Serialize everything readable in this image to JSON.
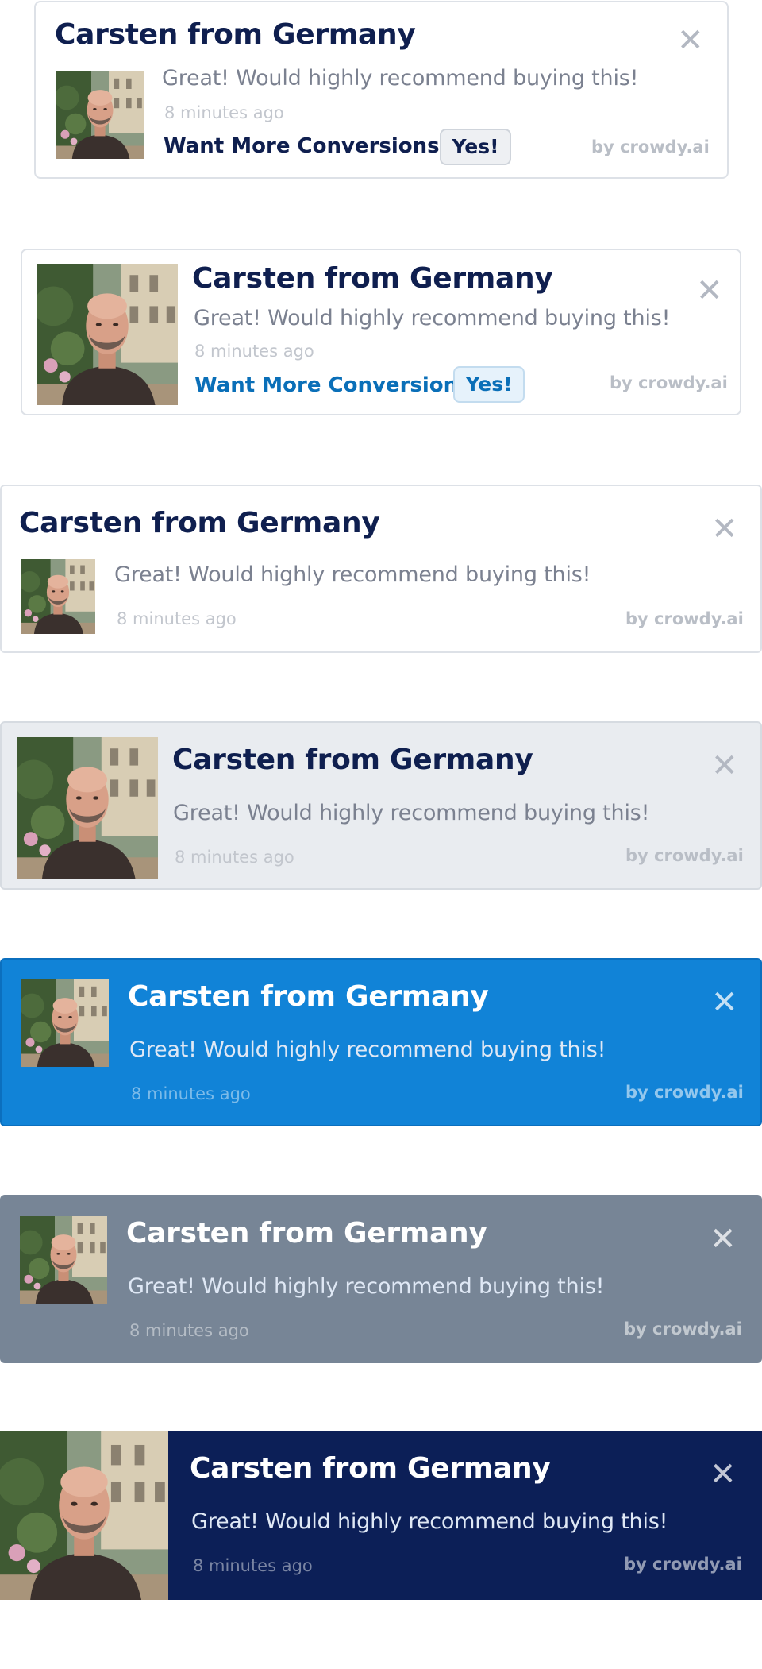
{
  "notifications": [
    {
      "title": "Carsten from Germany",
      "message": "Great! Would highly recommend buying this!",
      "time": "8 minutes ago",
      "cta": "Want More Conversions?",
      "yes": "Yes!",
      "by": "by crowdy.ai",
      "close": "✕"
    },
    {
      "title": "Carsten from Germany",
      "message": "Great! Would highly recommend buying this!",
      "time": "8 minutes ago",
      "cta": "Want More Conversions?",
      "yes": "Yes!",
      "by": "by crowdy.ai",
      "close": "✕"
    },
    {
      "title": "Carsten from Germany",
      "message": "Great! Would highly recommend buying this!",
      "time": "8 minutes ago",
      "by": "by crowdy.ai",
      "close": "✕"
    },
    {
      "title": "Carsten from Germany",
      "message": "Great! Would highly recommend buying this!",
      "time": "8 minutes ago",
      "by": "by crowdy.ai",
      "close": "✕"
    },
    {
      "title": "Carsten from Germany",
      "message": "Great! Would highly recommend buying this!",
      "time": "8 minutes ago",
      "by": "by crowdy.ai",
      "close": "✕"
    },
    {
      "title": "Carsten from Germany",
      "message": "Great! Would highly recommend buying this!",
      "time": "8 minutes ago",
      "by": "by crowdy.ai",
      "close": "✕"
    },
    {
      "title": "Carsten from Germany",
      "message": "Great! Would highly recommend buying this!",
      "time": "8 minutes ago",
      "by": "by crowdy.ai",
      "close": "✕"
    }
  ],
  "colors": {
    "navy_text": "#0f1f4f",
    "blue_link": "#0a6fb8",
    "theme_light_gray": "#e9ecf0",
    "theme_blue": "#1183d7",
    "theme_slate": "#778596",
    "theme_navy": "#0c1f57"
  },
  "icons": {
    "close": "close-icon",
    "avatar": "avatar-photo"
  }
}
